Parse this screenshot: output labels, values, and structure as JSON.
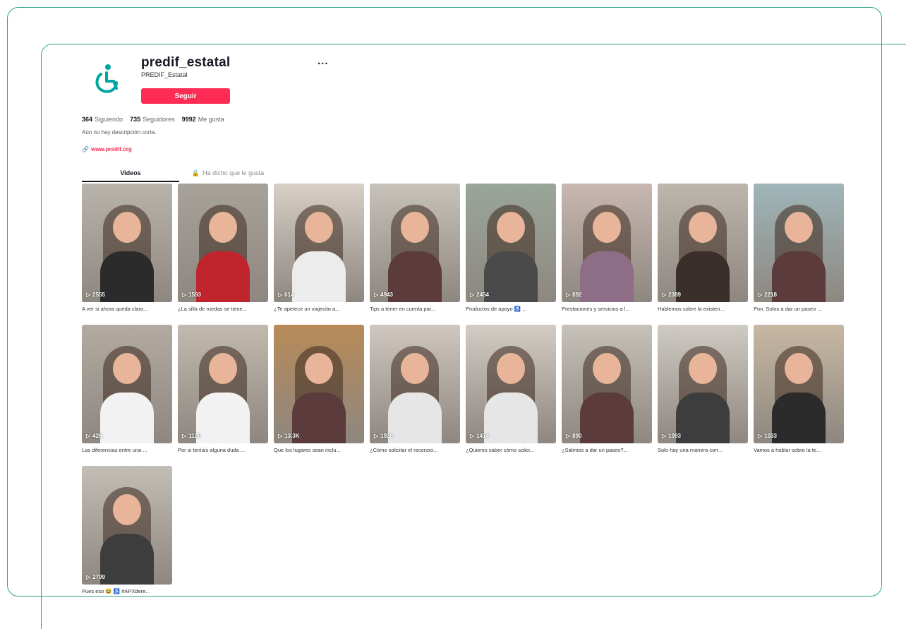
{
  "profile": {
    "username": "predif_estatal",
    "nickname": "PREDIF_Estatal",
    "more": "...",
    "follow_label": "Seguir",
    "stats": [
      {
        "value": "364",
        "label": "Siguiendo"
      },
      {
        "value": "735",
        "label": "Seguidores"
      },
      {
        "value": "9992",
        "label": "Me gusta"
      }
    ],
    "bio": "Aún no hay descripción corta.",
    "link": "www.predif.org"
  },
  "colors": {
    "accent": "#fe2c55",
    "frame": "#2ea58a",
    "logo": "#00a5a0"
  },
  "tabs": [
    {
      "label": "Videos"
    },
    {
      "label": "Ha dicho que le gusta"
    }
  ],
  "videos": [
    {
      "views": "2555",
      "caption": "A ver si ahora queda claro...",
      "bg": "#b9b4ab",
      "body": "#2b2b2b"
    },
    {
      "views": "1593",
      "caption": "¿La silla de ruedas se tiene...",
      "bg": "#a7a29a",
      "body": "#c0242c"
    },
    {
      "views": "614",
      "caption": "¿Te apetece un viajecito a...",
      "bg": "#d8cfc6",
      "body": "#ececec"
    },
    {
      "views": "4943",
      "caption": "Tips a tener en cuenta par...",
      "bg": "#c7c2ba",
      "body": "#5b3b3b"
    },
    {
      "views": "2454",
      "caption": "Productos de apoyo ♿ ...",
      "bg": "#9aa69a",
      "body": "#4a4a4a"
    },
    {
      "views": "892",
      "caption": "Prestaciones y servicios a l...",
      "bg": "#c8b7b0",
      "body": "#8d6e86"
    },
    {
      "views": "2389",
      "caption": "Hablemos sobre la existen...",
      "bg": "#bdb6ac",
      "body": "#3a2f2a"
    },
    {
      "views": "2218",
      "caption": "Pon. Solos a dar un paseo ...",
      "bg": "#9fb5b9",
      "body": "#5b3b3b"
    },
    {
      "views": "42K",
      "caption": "Las diferencias entre una ...",
      "bg": "#b3aaa1",
      "body": "#f2f2f2"
    },
    {
      "views": "1120",
      "caption": "Por si teníais alguna duda ...",
      "bg": "#c2b9ae",
      "body": "#f2f2f2"
    },
    {
      "views": "13.3K",
      "caption": "Que los lugares sean inclu...",
      "bg": "#b78a58",
      "body": "#5b3b3b"
    },
    {
      "views": "1928",
      "caption": "¿Cómo solicitar el reconoci...",
      "bg": "#cfc7bf",
      "body": "#e6e6e6"
    },
    {
      "views": "1414",
      "caption": "¿Quieres saber cómo solici...",
      "bg": "#d3ccc4",
      "body": "#e6e6e6"
    },
    {
      "views": "890",
      "caption": "¿Salimos a dar un paseo?...",
      "bg": "#c6c1b9",
      "body": "#5b3b3b"
    },
    {
      "views": "1093",
      "caption": "Solo hay una manera corr...",
      "bg": "#cfcac3",
      "body": "#3d3d3d"
    },
    {
      "views": "1033",
      "caption": "Vamos a hablar sobre la te...",
      "bg": "#c7b8a2",
      "body": "#2b2b2b"
    },
    {
      "views": "2799",
      "caption": "Pues eso 😂 ♿ #APXdere...",
      "bg": "#c2bdb5",
      "body": "#3d3d3d"
    }
  ]
}
